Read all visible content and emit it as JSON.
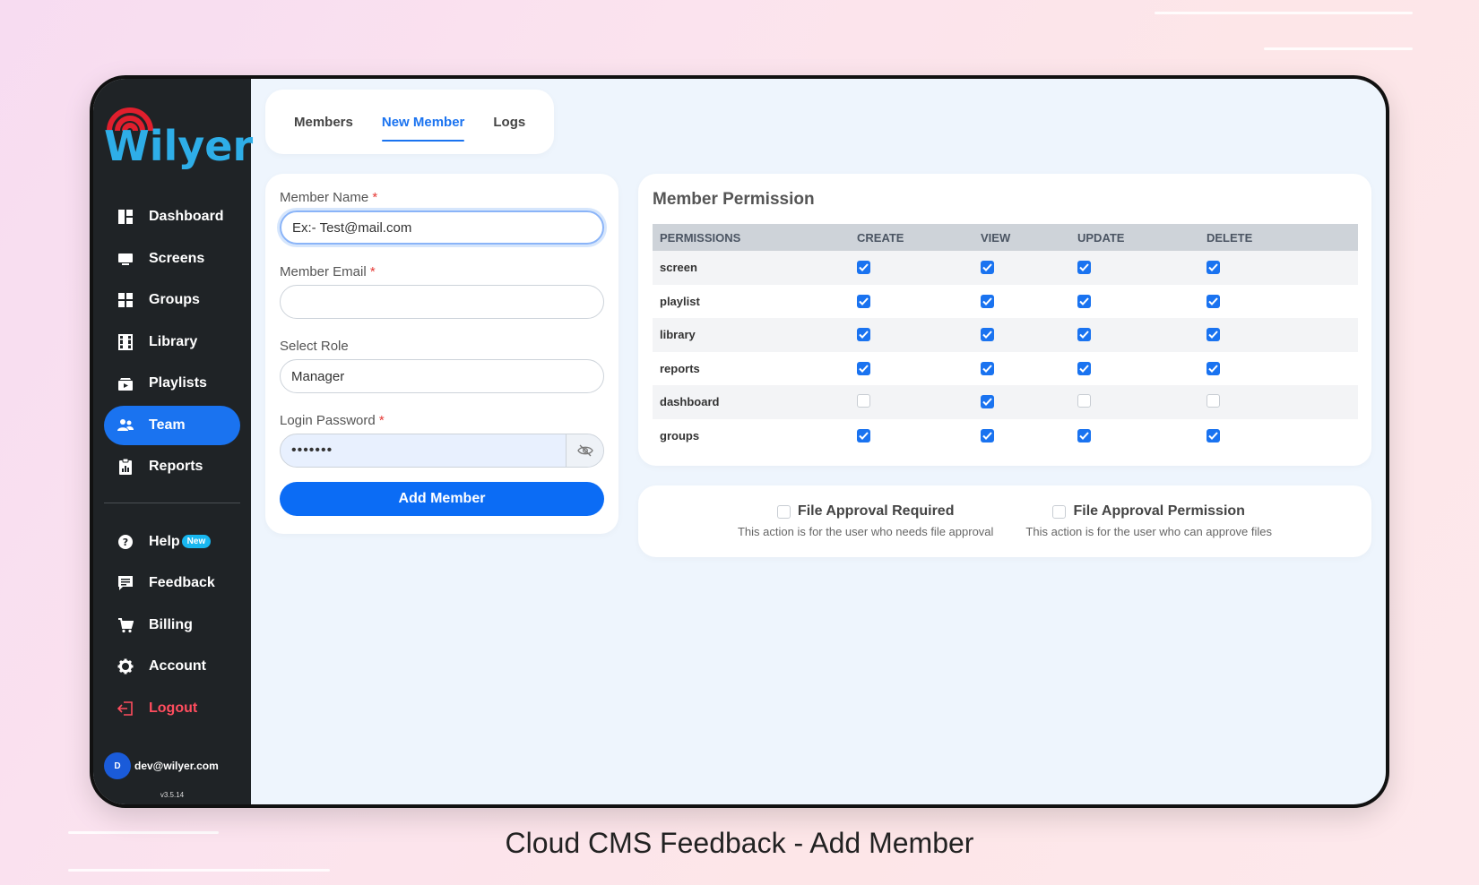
{
  "brand": {
    "name": "Wilyer",
    "arc_color": "#e01f2d",
    "text_color": "#2eaee8"
  },
  "sidebar": {
    "items": [
      {
        "label": "Dashboard",
        "icon": "dashboard-icon"
      },
      {
        "label": "Screens",
        "icon": "monitor-icon"
      },
      {
        "label": "Groups",
        "icon": "grid-icon"
      },
      {
        "label": "Library",
        "icon": "film-icon"
      },
      {
        "label": "Playlists",
        "icon": "playlist-icon"
      },
      {
        "label": "Team",
        "icon": "users-icon",
        "active": true
      },
      {
        "label": "Reports",
        "icon": "report-icon"
      }
    ],
    "secondary": [
      {
        "label": "Help",
        "icon": "help-icon",
        "badge": "New"
      },
      {
        "label": "Feedback",
        "icon": "feedback-icon"
      },
      {
        "label": "Billing",
        "icon": "cart-icon"
      },
      {
        "label": "Account",
        "icon": "gear-icon"
      },
      {
        "label": "Logout",
        "icon": "logout-icon"
      }
    ],
    "user": {
      "initial": "D",
      "email": "dev@wilyer.com"
    },
    "version": "v3.5.14"
  },
  "tabs": [
    {
      "label": "Members"
    },
    {
      "label": "New Member",
      "active": true
    },
    {
      "label": "Logs"
    }
  ],
  "form": {
    "name_label": "Member Name",
    "name_placeholder": "Ex:- Test@mail.com",
    "email_label": "Member Email",
    "role_label": "Select Role",
    "role_value": "Manager",
    "password_label": "Login Password",
    "password_value": "•••••••",
    "required_mark": "*",
    "submit_label": "Add Member"
  },
  "permissions": {
    "title": "Member Permission",
    "columns": [
      "PERMISSIONS",
      "CREATE",
      "VIEW",
      "UPDATE",
      "DELETE"
    ],
    "rows": [
      {
        "name": "screen",
        "create": true,
        "view": true,
        "update": true,
        "delete": true
      },
      {
        "name": "playlist",
        "create": true,
        "view": true,
        "update": true,
        "delete": true
      },
      {
        "name": "library",
        "create": true,
        "view": true,
        "update": true,
        "delete": true
      },
      {
        "name": "reports",
        "create": true,
        "view": true,
        "update": true,
        "delete": true
      },
      {
        "name": "dashboard",
        "create": false,
        "view": true,
        "update": false,
        "delete": false
      },
      {
        "name": "groups",
        "create": true,
        "view": true,
        "update": true,
        "delete": true
      }
    ]
  },
  "approval": {
    "required_label": "File Approval Required",
    "required_desc": "This action is for the user who needs file approval",
    "permission_label": "File Approval Permission",
    "permission_desc": "This action is for the user who can approve files"
  },
  "caption": "Cloud CMS Feedback - Add Member",
  "colors": {
    "accent": "#1a73f0",
    "sidebar_bg": "#1f2326",
    "logout": "#ff4d5e"
  }
}
